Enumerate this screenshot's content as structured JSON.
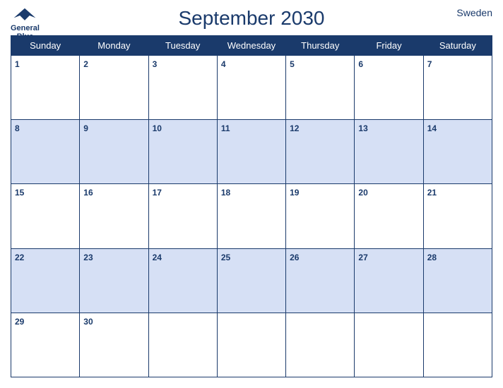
{
  "header": {
    "title": "September 2030",
    "country": "Sweden",
    "logo_line1": "General",
    "logo_line2": "Blue"
  },
  "days_of_week": [
    "Sunday",
    "Monday",
    "Tuesday",
    "Wednesday",
    "Thursday",
    "Friday",
    "Saturday"
  ],
  "weeks": [
    [
      {
        "day": 1
      },
      {
        "day": 2
      },
      {
        "day": 3
      },
      {
        "day": 4
      },
      {
        "day": 5
      },
      {
        "day": 6
      },
      {
        "day": 7
      }
    ],
    [
      {
        "day": 8
      },
      {
        "day": 9
      },
      {
        "day": 10
      },
      {
        "day": 11
      },
      {
        "day": 12
      },
      {
        "day": 13
      },
      {
        "day": 14
      }
    ],
    [
      {
        "day": 15
      },
      {
        "day": 16
      },
      {
        "day": 17
      },
      {
        "day": 18
      },
      {
        "day": 19
      },
      {
        "day": 20
      },
      {
        "day": 21
      }
    ],
    [
      {
        "day": 22
      },
      {
        "day": 23
      },
      {
        "day": 24
      },
      {
        "day": 25
      },
      {
        "day": 26
      },
      {
        "day": 27
      },
      {
        "day": 28
      }
    ],
    [
      {
        "day": 29
      },
      {
        "day": 30
      },
      {
        "day": ""
      },
      {
        "day": ""
      },
      {
        "day": ""
      },
      {
        "day": ""
      },
      {
        "day": ""
      }
    ]
  ],
  "accent_color": "#1a3a6b",
  "row_alt_color": "#d6e0f5"
}
